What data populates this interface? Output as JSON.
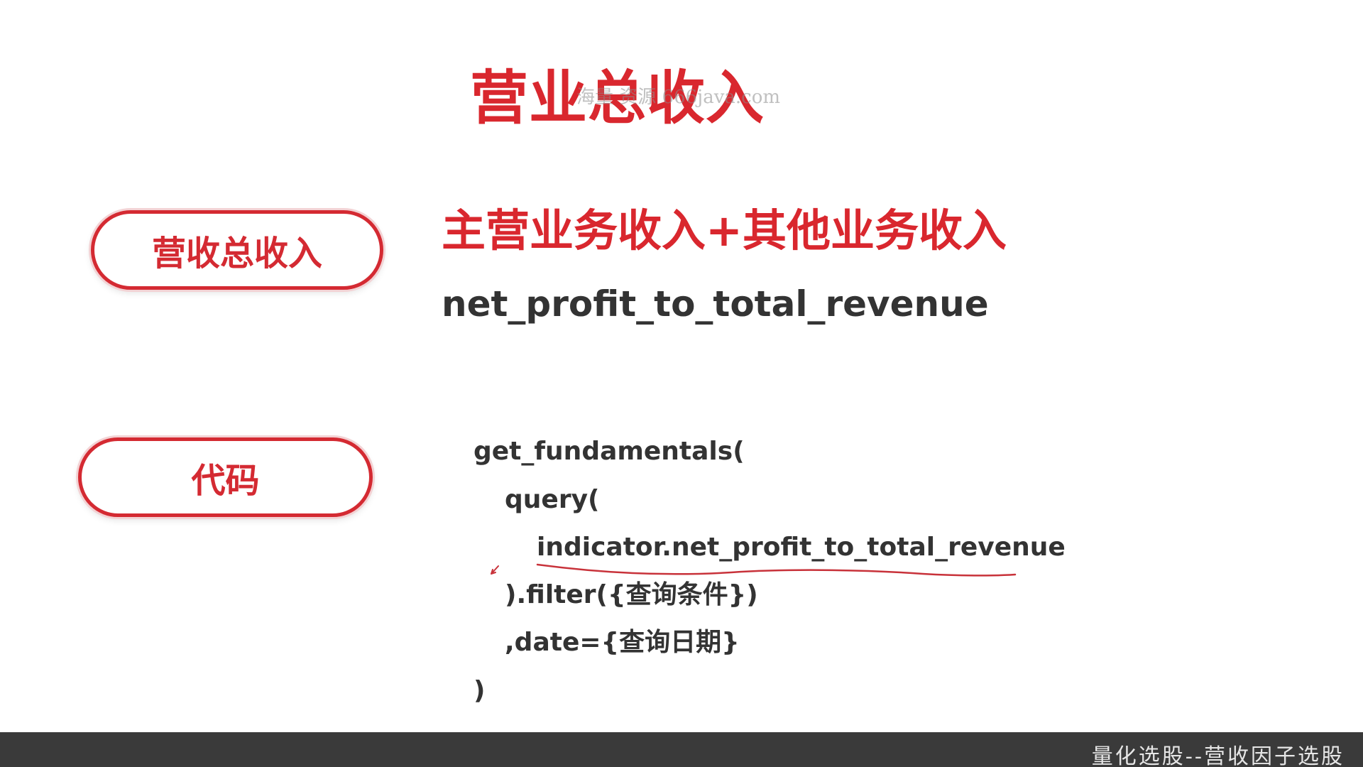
{
  "slide": {
    "title": "营业总收入",
    "watermark": "海量 资源 666java.com",
    "labels": {
      "revenue": "营收总收入",
      "code": "代码"
    },
    "formula": "主营业务收入+其他业务收入",
    "field_name": "net_profit_to_total_revenue",
    "code_lines": [
      "get_fundamentals(",
      "query(",
      "indicator.net_profit_to_total_revenue",
      ").filter({查询条件})",
      ",date={查询日期}",
      ")"
    ],
    "accent_color": "#d9272e",
    "text_color": "#333333"
  },
  "footer": {
    "text": "量化选股--营收因子选股",
    "background": "#3a3a3a"
  }
}
